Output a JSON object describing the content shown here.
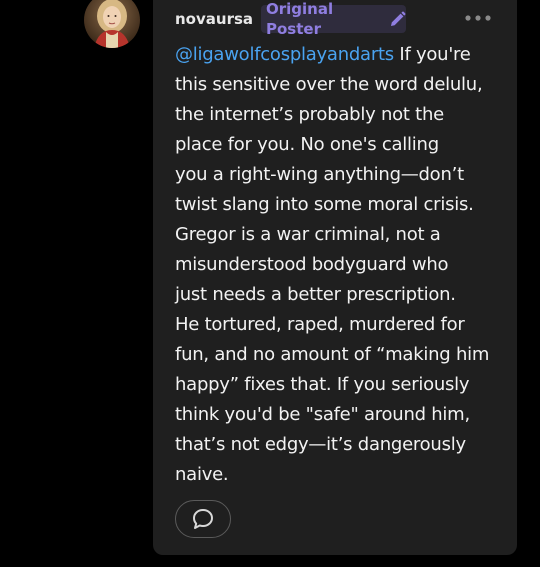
{
  "post": {
    "author": {
      "username": "novaursa",
      "badge_label": "Original Poster",
      "badge_icon": "pencil-icon",
      "avatar_icon": "avatar-portrait"
    },
    "more_icon": "more-options-icon",
    "reply_icon": "comment-bubble-icon",
    "body": {
      "mention": "@ligawolfcosplayandarts",
      "first_line_rest": " If you're",
      "lines": [
        "this sensitive over the word delulu,",
        "the internet’s probably not the",
        "place for you. No one's calling",
        "you a right-wing anything—don’t",
        "twist slang into some moral crisis.",
        "Gregor is a war criminal, not a",
        "misunderstood bodyguard who",
        "just needs a better prescription.",
        "He tortured, raped, murdered for",
        "fun, and no amount of “making him",
        "happy” fixes that. If you seriously",
        "think you'd be \"safe\" around him,",
        "that’s not edgy—it’s dangerously",
        "naive."
      ]
    }
  },
  "colors": {
    "background": "#000000",
    "card": "#1f1f1f",
    "username": "#e8e8e8",
    "badge_bg": "#2f2c3d",
    "badge_text": "#8f7ee0",
    "mention": "#4aa3f0",
    "body_text": "#f2f2f2"
  }
}
